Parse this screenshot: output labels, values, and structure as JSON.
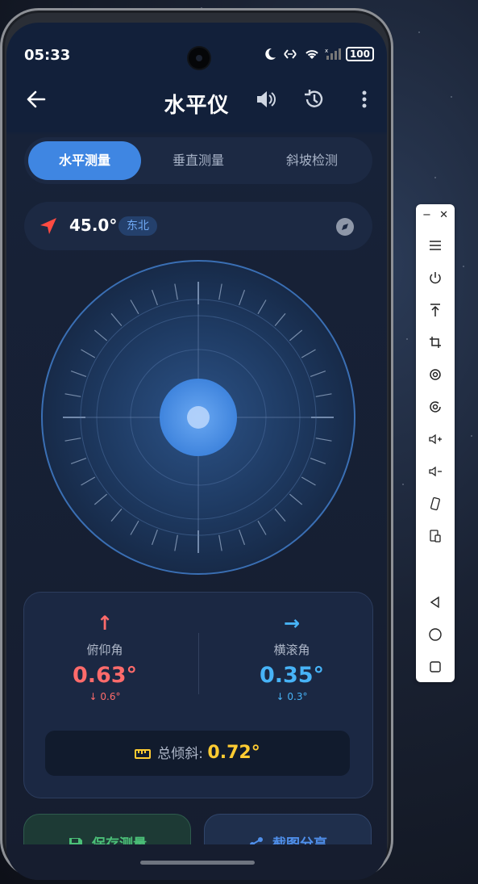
{
  "status_bar": {
    "time": "05:33",
    "battery": "100"
  },
  "app_bar": {
    "title": "水平仪"
  },
  "tabs": [
    {
      "label": "水平测量",
      "active": true
    },
    {
      "label": "垂直测量",
      "active": false
    },
    {
      "label": "斜坡检测",
      "active": false
    }
  ],
  "compass": {
    "heading": "45.0°",
    "direction": "东北"
  },
  "level": {
    "pitch": 0.63,
    "roll": 0.35
  },
  "readings": {
    "pitch": {
      "label": "俯仰角",
      "value": "0.63°",
      "sub": "↓ 0.6°",
      "arrow": "↑",
      "color": "#ff6b6b"
    },
    "roll": {
      "label": "横滚角",
      "value": "0.35°",
      "sub": "↓ 0.3°",
      "arrow": "→",
      "color": "#47b3f7"
    },
    "total": {
      "label": "总倾斜:",
      "value": "0.72°",
      "color": "#ffcc32"
    }
  },
  "actions": {
    "save_label": "保存测量",
    "share_label": "截图分享"
  },
  "emulator_toolbar": {
    "items": [
      "menu-icon",
      "power-icon",
      "rotate-to-top-icon",
      "crop-icon",
      "rotate-left-icon",
      "rotate-right-icon",
      "volume-up-icon",
      "volume-down-icon",
      "shake-icon",
      "screen-switch-icon",
      "back-icon",
      "home-icon",
      "overview-icon"
    ]
  }
}
